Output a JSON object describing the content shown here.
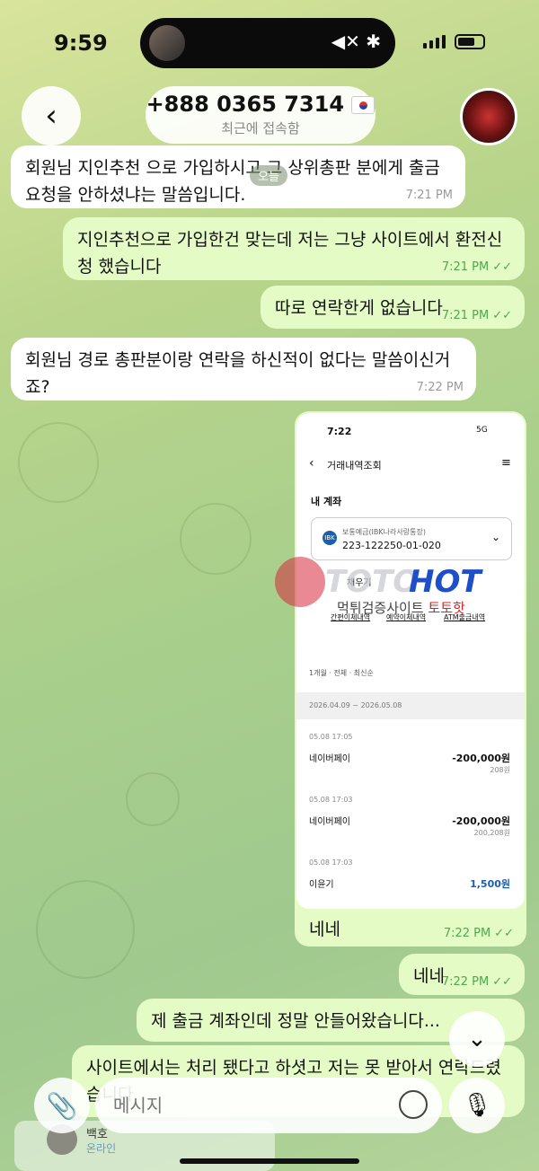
{
  "status_bar": {
    "time": "9:59"
  },
  "header": {
    "title": "+888 0365 7314",
    "subtitle": "최근에 접속함"
  },
  "date_chip": "오늘",
  "messages": [
    {
      "dir": "in",
      "text": "회원님 지인추천 으로 가입하시고 그 상위총판 분에게 출금 요청을 안하셨냐는 말씀입니다.",
      "time": "7:21 PM"
    },
    {
      "dir": "out",
      "text": "지인추천으로 가입한건 맞는데 저는 그냥 사이트에서 환전신청 했습니다",
      "time": "7:21 PM"
    },
    {
      "dir": "out",
      "text": "따로 연락한게 없습니다",
      "time": "7:21 PM"
    },
    {
      "dir": "in",
      "text": "회원님 경로 총판분이랑 연락을 하신적이 없다는 말씀이신거죠?",
      "time": "7:22 PM"
    },
    {
      "dir": "out",
      "text": "네네",
      "time": "7:22 PM"
    },
    {
      "dir": "out",
      "text": "네네",
      "time": "7:22 PM"
    },
    {
      "dir": "out",
      "text": "제 출금 계좌인데 정말 안들어왔습니다...",
      "time": ""
    },
    {
      "dir": "out",
      "text": "사이트에서는 처리 됐다고 하셧고 저는 못 받아서 연락드렸습니다",
      "time": ""
    }
  ],
  "bank_screenshot": {
    "time": "7:22",
    "network": "5G",
    "title": "거래내역조회",
    "section": "내 계좌",
    "account_type": "보통예금(IBK나라사랑통장)",
    "account_number": "223-122250-01-020",
    "bank_badge": "IBK",
    "tab_left": "채우기",
    "tab_right": "이체",
    "sub_tabs": [
      "간편이체내역",
      "예약이체내역",
      "ATM출금내역"
    ],
    "filter": "1개월 · 전체 · 최신순",
    "date_range": "2026.04.09 ~ 2026.05.08",
    "transactions": [
      {
        "datetime": "05.08 17:05",
        "name": "네이버페이",
        "amount": "-200,000원",
        "balance": "208원"
      },
      {
        "datetime": "05.08 17:03",
        "name": "네이버페이",
        "amount": "-200,000원",
        "balance": "200,208원"
      },
      {
        "datetime": "05.08 17:03",
        "name": "이윤기",
        "amount": "1,500원",
        "balance": ""
      }
    ]
  },
  "watermark": {
    "logo_left": "TOTO",
    "logo_right": "HOT",
    "subtitle": "먹튀검증사이트",
    "subtitle_brand": "토토핫"
  },
  "composer": {
    "placeholder": "메시지"
  },
  "mini_chat": {
    "name": "백호",
    "status": "온라인"
  },
  "colors": {
    "incoming": "#ffffff",
    "outgoing": "#e4fbc6",
    "time_outgoing": "#4caa4a",
    "deposit": "#1b5fae"
  }
}
